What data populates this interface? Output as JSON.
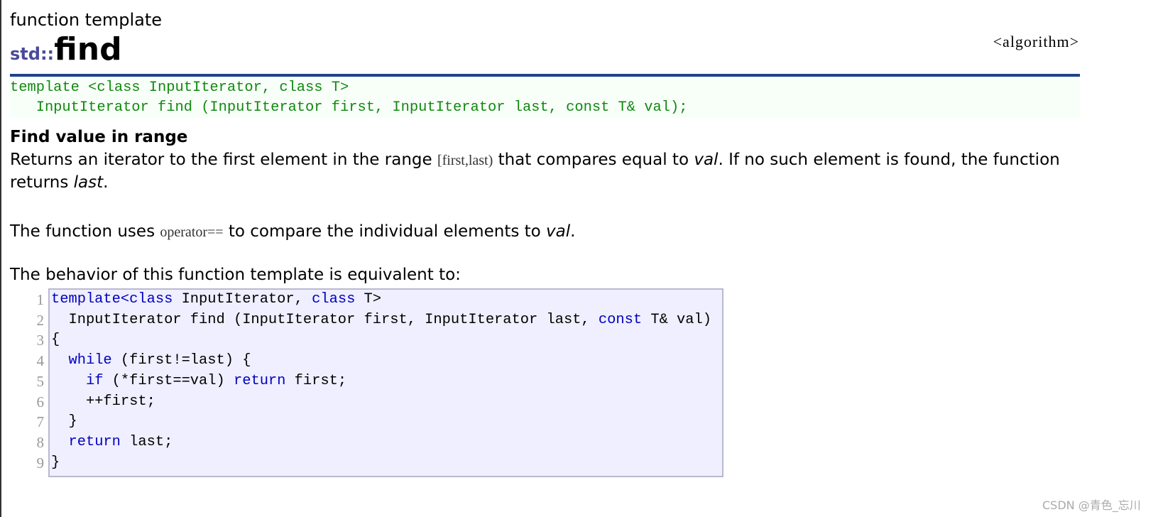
{
  "page": {
    "kind": "function template",
    "namespace": "std::",
    "name": "find",
    "header": "<algorithm>",
    "prototype": [
      "template <class InputIterator, class T>",
      "   InputIterator find (InputIterator first, InputIterator last, const T& val);"
    ],
    "section_title": "Find value in range",
    "p1": {
      "a": "Returns an iterator to the first element in the range ",
      "range": "[first,last)",
      "b": " that compares equal to ",
      "val": "val",
      "c": ". If no such element is found, the function returns ",
      "last": "last",
      "d": "."
    },
    "p2": {
      "a": "The function uses ",
      "op": "operator==",
      "b": " to compare the individual elements to ",
      "val": "val",
      "c": "."
    },
    "p3": "The behavior of this function template is equivalent to:",
    "code_lines": [
      [
        {
          "t": "template",
          "k": 1
        },
        {
          "t": "<class",
          "k": 1
        },
        {
          "t": " InputIterator, ",
          "k": 0
        },
        {
          "t": "class",
          "k": 1
        },
        {
          "t": " T>",
          "k": 0
        }
      ],
      [
        {
          "t": "  InputIterator find (InputIterator first, InputIterator last, ",
          "k": 0
        },
        {
          "t": "const",
          "k": 1
        },
        {
          "t": " T& val)",
          "k": 0
        }
      ],
      [
        {
          "t": "{",
          "k": 0
        }
      ],
      [
        {
          "t": "  ",
          "k": 0
        },
        {
          "t": "while",
          "k": 1
        },
        {
          "t": " (first!=last) {",
          "k": 0
        }
      ],
      [
        {
          "t": "    ",
          "k": 0
        },
        {
          "t": "if",
          "k": 1
        },
        {
          "t": " (*first==val) ",
          "k": 0
        },
        {
          "t": "return",
          "k": 1
        },
        {
          "t": " first;",
          "k": 0
        }
      ],
      [
        {
          "t": "    ++first;",
          "k": 0
        }
      ],
      [
        {
          "t": "  }",
          "k": 0
        }
      ],
      [
        {
          "t": "  ",
          "k": 0
        },
        {
          "t": "return",
          "k": 1
        },
        {
          "t": " last;",
          "k": 0
        }
      ],
      [
        {
          "t": "}",
          "k": 0
        }
      ]
    ],
    "line_numbers": [
      "1",
      "2",
      "3",
      "4",
      "5",
      "6",
      "7",
      "8",
      "9"
    ],
    "watermark": "CSDN @青色_忘川"
  },
  "colors": {
    "rule": "#22408c",
    "prototype": "#118811",
    "keyword": "#0000c0",
    "code_bg": "#efefff"
  }
}
